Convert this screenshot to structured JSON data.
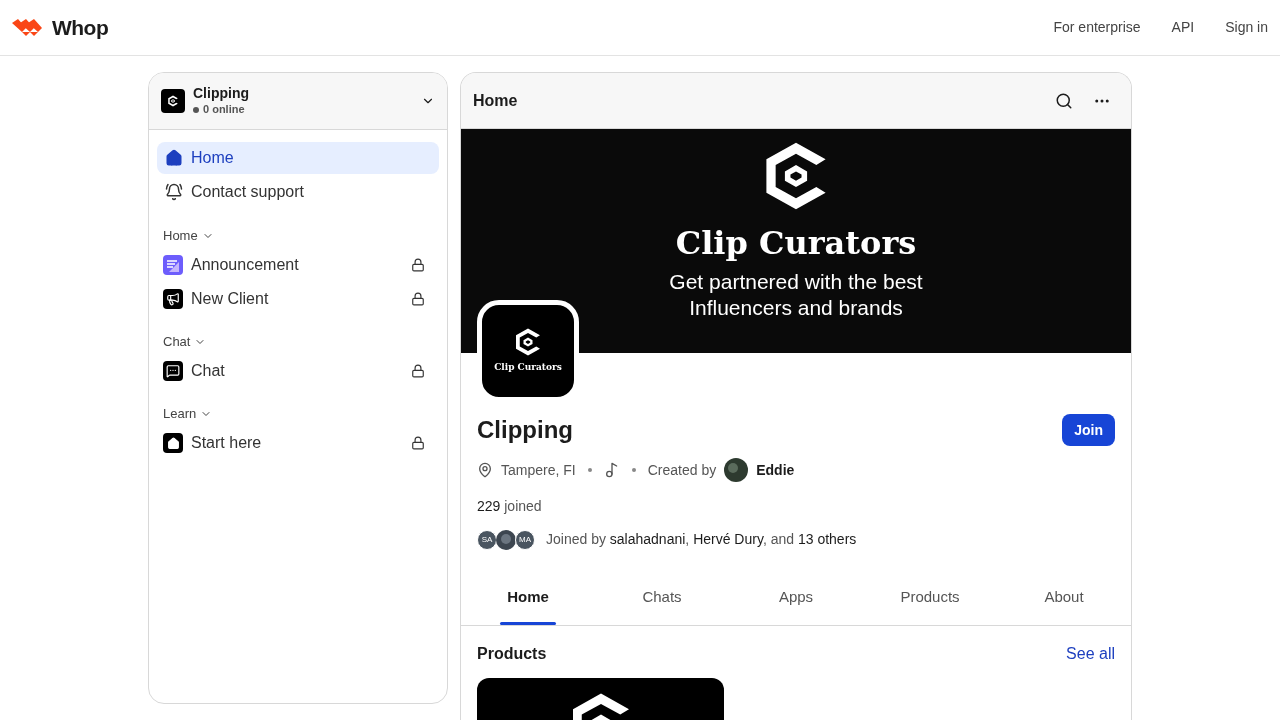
{
  "header": {
    "brand": "Whop",
    "links": [
      "For enterprise",
      "API",
      "Sign in"
    ]
  },
  "sidebar": {
    "title": "Clipping",
    "online": "0 online",
    "top_items": [
      {
        "label": "Home",
        "kind": "home",
        "selected": true
      },
      {
        "label": "Contact support",
        "kind": "bell",
        "selected": false
      }
    ],
    "sections": [
      {
        "title": "Home",
        "items": [
          {
            "label": "Announcement",
            "kind": "announcement",
            "locked": true
          },
          {
            "label": "New Client",
            "kind": "megaphone",
            "locked": true
          }
        ]
      },
      {
        "title": "Chat",
        "items": [
          {
            "label": "Chat",
            "kind": "chat",
            "locked": true
          }
        ]
      },
      {
        "title": "Learn",
        "items": [
          {
            "label": "Start here",
            "kind": "course",
            "locked": true
          }
        ]
      }
    ]
  },
  "main": {
    "title": "Home",
    "banner": {
      "title": "Clip Curators",
      "lines": [
        "Get partnered with the best",
        "Influencers and brands"
      ]
    },
    "logo_text": "Clip Curators",
    "name": "Clipping",
    "join": "Join",
    "location": "Tampere, FI",
    "created_by": "Created by",
    "creator": "Eddie",
    "joined_count": "229",
    "joined_label": "joined",
    "member_avatars": [
      {
        "initials": "SA",
        "kind": "initials"
      },
      {
        "kind": "photo"
      },
      {
        "initials": "MA",
        "kind": "initials"
      }
    ],
    "joined_by": "Joined by **salahadnani**, **Hervé Dury**, and **13 others**",
    "tabs": [
      {
        "label": "Home",
        "selected": true
      },
      {
        "label": "Chats",
        "selected": false
      },
      {
        "label": "Apps",
        "selected": false
      },
      {
        "label": "Products",
        "selected": false
      },
      {
        "label": "About",
        "selected": false
      }
    ],
    "products": {
      "title": "Products",
      "see_all": "See all"
    }
  }
}
